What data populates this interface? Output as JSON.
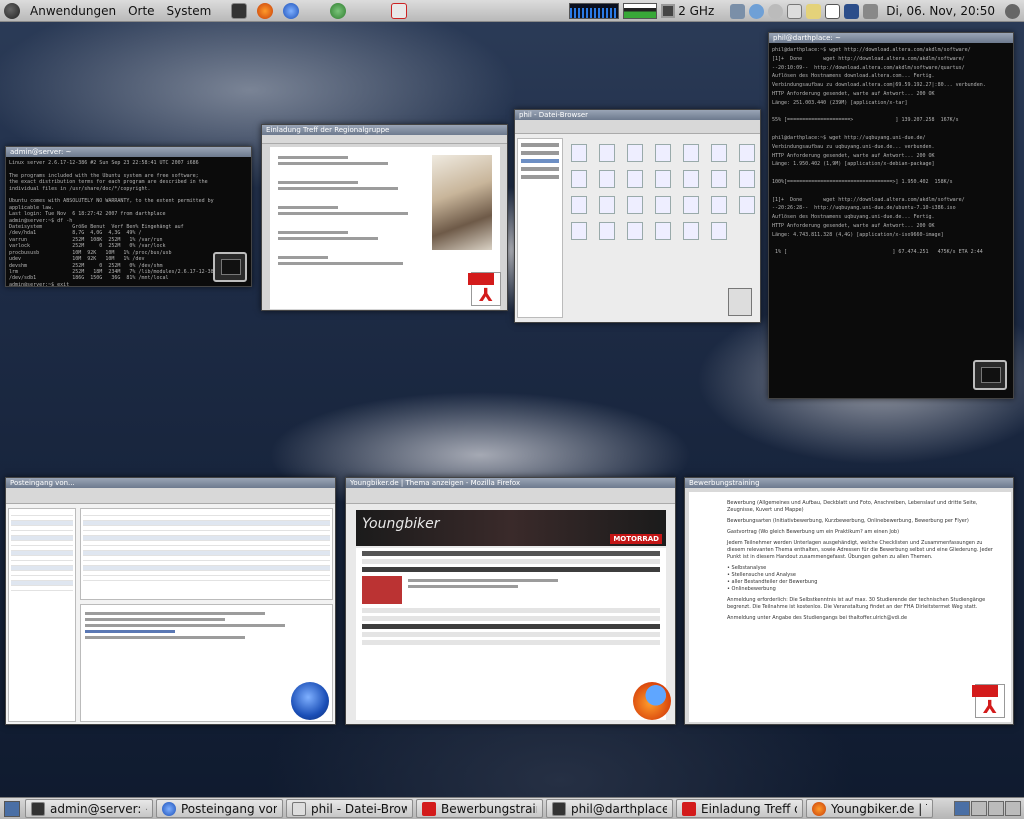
{
  "top_panel": {
    "menus": [
      "Anwendungen",
      "Orte",
      "System"
    ],
    "cpu_freq": "2 GHz",
    "clock": "Di, 06. Nov, 20:50"
  },
  "windows": {
    "terminal_small": {
      "title": "admin@server: ~",
      "lines": [
        "Linux server 2.6.17-12-386 #2 Sun Sep 23 22:58:41 UTC 2007 i686",
        "",
        "The programs included with the Ubuntu system are free software;",
        "the exact distribution terms for each program are described in the",
        "individual files in /usr/share/doc/*/copyright.",
        "",
        "Ubuntu comes with ABSOLUTELY NO WARRANTY, to the extent permitted by",
        "applicable law.",
        "Last login: Tue Nov  6 18:27:42 2007 from darthplace",
        "admin@server:~$ df -h",
        "Dateisystem          Größe Benut  Verf Ben% Eingehängt auf",
        "/dev/hda1            8,7G  4,0G  4,3G  49% /",
        "varrun               252M  108K  252M   1% /var/run",
        "varlock              252M     0  252M   0% /var/lock",
        "procbususb           10M  92K   10M   1% /proc/bus/usb",
        "udev                 10M  92K   10M   1% /dev",
        "devshm               252M     0  252M   0% /dev/shm",
        "lrm                  252M   18M  234M   7% /lib/modules/2.6.17-12-386/volatile",
        "/dev/sdb1            186G  150G   36G  81% /mnt/local",
        "admin@server:~$ exit",
        "logout",
        "Connection to 192.168.0.1 closed.",
        "phil@darthplace:~$ "
      ]
    },
    "pdf_top": {
      "title": "Einladung Treff der Regionalgruppe"
    },
    "filebrowser": {
      "title": "phil - Datei-Browser"
    },
    "terminal_large": {
      "title": "phil@darthplace: ~",
      "lines": [
        "phil@darthplace:~$ wget http://download.altera.com/akdlm/software/",
        "[1]+  Done       wget http://download.altera.com/akdlm/software/",
        "--20:10:09--  http://download.altera.com/akdlm/software/quartus/",
        "Auflösen des Hostnamens download.altera.com... Fertig.",
        "Verbindungsaufbau zu download.altera.com|69.59.192.27|:80... verbunden.",
        "HTTP Anforderung gesendet, warte auf Antwort... 200 OK",
        "Länge: 251.003.440 (239M) [application/x-tar]",
        "",
        "55% [=====================>              ] 139.207.258  167K/s",
        "",
        "phil@darthplace:~$ wget http://uqbuyang.uni-due.de/",
        "Verbindungsaufbau zu uqbuyang.uni-due.de... verbunden.",
        "HTTP Anforderung gesendet, warte auf Antwort... 200 OK",
        "Länge: 1.950.402 (1,9M) [application/x-debian-package]",
        "",
        "100%[===================================>] 1.950.402  158K/s",
        "",
        "[1]+  Done       wget http://download.altera.com/akdlm/software/",
        "--20:26:28--  http://uqbuyang.uni-due.de/ubuntu-7.10-i386.iso",
        "Auflösen des Hostnamens uqbuyang.uni-due.de... Fertig.",
        "HTTP Anforderung gesendet, warte auf Antwort... 200 OK",
        "Länge: 4.743.811.328 (4,4G) [application/x-iso9660-image]",
        "",
        " 1% [                                   ] 67.474.251   475K/s ETA 2:44"
      ]
    },
    "mail": {
      "title": "Posteingang von..."
    },
    "firefox": {
      "title": "Youngbiker.de | Thema anzeigen - Mozilla Firefox",
      "banner": "Youngbiker",
      "banner_tag": "MOTORRAD"
    },
    "pdf_bottom": {
      "title": "Bewerbungstraining",
      "paragraphs": [
        "Bewerbung (Allgemeines und Aufbau, Deckblatt und Foto, Anschreiben, Lebenslauf und dritte Seite, Zeugnisse, Kuvert und Mappe)",
        "Bewerbungsarten (Initiativbewerbung, Kurzbewerbung, Onlinebewerbung, Bewerbung per Flyer)",
        "Gastvortrag (Wo gleich Bewerbung um ein Praktikum? am einen Job)",
        "Jedem Teilnehmer werden Unterlagen ausgehändigt, welche Checklisten und Zusammenfassungen zu diesem relevanten Thema enthalten, sowie Adressen für die Bewerbung selbst und eine Gliederung. Jeder Punkt ist in diesem Handout zusammengefasst. Übungen gehen zu allen Themen.",
        "• Selbstanalyse",
        "• Stellensuche und Analyse",
        "• aller Bestandteiler der Bewerbung",
        "• Onlinebewerbung",
        "Anmeldung erforderlich: Die Selbstkenntnis ist auf max. 30 Studierende der technischen Studiengänge begrenzt. Die Teilnahme ist kostenlos. Die Veranstaltung findet an der FHA Dirleitstermet Weg statt.",
        "Anmeldung unter Angabe des Studiengangs bei thaltoffer.ulrich@vdi.de"
      ]
    }
  },
  "taskbar": {
    "tasks": [
      "admin@server: ~",
      "Posteingang von...",
      "phil - Datei-Brows...",
      "Bewerbungstrain...",
      "phil@darthplace:...",
      "Einladung Treff d...",
      "Youngbiker.de | T..."
    ]
  },
  "colors": {
    "panel": "#c8c8c8",
    "terminal_bg": "#0b0b0b",
    "pdf_red": "#d31b1b",
    "firefox_orange": "#e8661b",
    "thunderbird_blue": "#1b4fb7"
  }
}
